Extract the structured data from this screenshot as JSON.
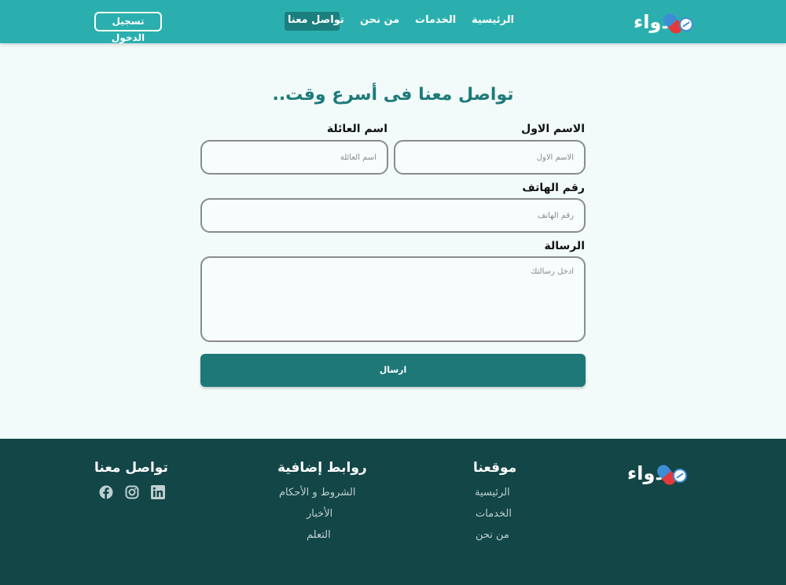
{
  "header": {
    "logo_text": "دواء",
    "nav": {
      "home": "الرئيسية",
      "services": "الخدمات",
      "about": "من نحن",
      "contact": "تواصل معنا"
    },
    "login_label": "تسجيل الدخول"
  },
  "form": {
    "title": "تواصل معنا فى أسرع وقت..",
    "first_name": {
      "label": "الاسم الاول",
      "placeholder": "الاسم الاول",
      "value": ""
    },
    "last_name": {
      "label": "اسم العائلة",
      "placeholder": "اسم العائلة",
      "value": ""
    },
    "phone": {
      "label": "رقم الهاتف",
      "placeholder": "رقم الهاتف",
      "value": ""
    },
    "message": {
      "label": "الرسالة",
      "placeholder": "ادخل رسالتك",
      "value": ""
    },
    "submit_label": "ارسال"
  },
  "footer": {
    "logo_text": "دواء",
    "site": {
      "heading": "موقعنا",
      "links": [
        "الرئيسية",
        "الخدمات",
        "من نحن"
      ]
    },
    "extra": {
      "heading": "روابط إضافية",
      "links": [
        "الشروط و الأحكام",
        "الأخبار",
        "التعلم"
      ]
    },
    "contact": {
      "heading": "تواصل معنا",
      "icons": [
        "linkedin-icon",
        "instagram-icon",
        "facebook-icon"
      ]
    }
  },
  "colors": {
    "header_bg": "#2aafae",
    "nav_active_bg": "#1c7f7f",
    "page_bg": "#f2fafa",
    "title_color": "#1e7a7a",
    "button_bg": "#1f7878",
    "footer_bg": "#134647",
    "pill_blue": "#3f8cd6",
    "pill_red": "#e23a3a"
  }
}
